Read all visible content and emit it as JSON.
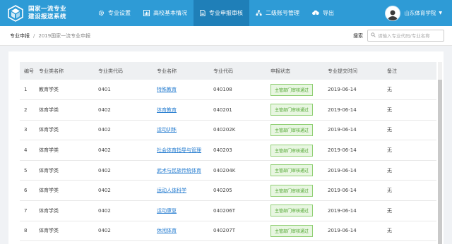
{
  "app": {
    "title_line1": "国家一流专业",
    "title_line2": "建设报送系统"
  },
  "nav": [
    {
      "label": "专业设置",
      "icon": "gear-icon"
    },
    {
      "label": "高校基本情况",
      "icon": "chart-icon"
    },
    {
      "label": "专业申报审核",
      "icon": "document-icon",
      "active": true
    },
    {
      "label": "二级账号管理",
      "icon": "org-chart-icon"
    },
    {
      "label": "导出",
      "icon": "cloud-download-icon"
    }
  ],
  "user": {
    "name": "山东体育学院"
  },
  "breadcrumb": {
    "root": "专业申报",
    "separator": "/",
    "current": "2019国家一流专业申报"
  },
  "search": {
    "label": "搜索",
    "placeholder": "请输入专业代码/专业名称",
    "value": ""
  },
  "table": {
    "headers": [
      "编号",
      "专业类名称",
      "专业类代码",
      "专业名称",
      "专业代码",
      "申报状态",
      "专业提交时间",
      "备注"
    ],
    "rows": [
      [
        "1",
        "教育学类",
        "0401",
        "特殊教育",
        "040108",
        "主管部门审核通过",
        "2019-06-14",
        "无"
      ],
      [
        "2",
        "体育学类",
        "0402",
        "体育教育",
        "040201",
        "主管部门审核通过",
        "2019-06-14",
        "无"
      ],
      [
        "3",
        "体育学类",
        "0402",
        "运动训练",
        "040202K",
        "主管部门审核通过",
        "2019-06-14",
        "无"
      ],
      [
        "4",
        "体育学类",
        "0402",
        "社会体育指导与管理",
        "040203",
        "主管部门审核通过",
        "2019-06-14",
        "无"
      ],
      [
        "5",
        "体育学类",
        "0402",
        "武术与民族传统体育",
        "040204K",
        "主管部门审核通过",
        "2019-06-14",
        "无"
      ],
      [
        "6",
        "体育学类",
        "0402",
        "运动人体科学",
        "040205",
        "主管部门审核通过",
        "2019-06-14",
        "无"
      ],
      [
        "7",
        "体育学类",
        "0402",
        "运动康复",
        "040206T",
        "主管部门审核通过",
        "2019-06-14",
        "无"
      ],
      [
        "8",
        "体育学类",
        "0402",
        "休闲体育",
        "040207T",
        "主管部门审核通过",
        "2019-06-14",
        "无"
      ]
    ]
  },
  "colors": {
    "header": "#2e9bd6",
    "nav_active": "#1f7fb8",
    "link": "#2a7fd1",
    "status_green": "#4ea52e"
  }
}
